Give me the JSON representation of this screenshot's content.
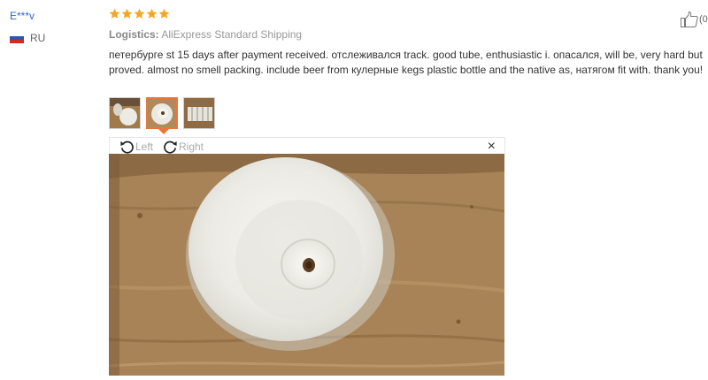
{
  "reviewer": {
    "name": "E***v",
    "country": "RU"
  },
  "rating": {
    "stars": 5,
    "color": "#f5a623"
  },
  "logistics": {
    "label": "Logistics:",
    "value": "AliExpress Standard Shipping"
  },
  "review": {
    "text": "петербурге st 15 days after payment received. отслеживался track. good tube, enthusiastic i. опасался, will be, very hard but proved. almost no smell packing. include beer from кулерные kegs plastic bottle and the native as, натягом fit with. thank you!"
  },
  "helpful": {
    "count_text": "(0"
  },
  "thumbnails": [
    {
      "icon": "photo-thumbnail",
      "active": false
    },
    {
      "icon": "photo-thumbnail",
      "active": true
    },
    {
      "icon": "photo-thumbnail",
      "active": false
    }
  ],
  "viewer": {
    "rotate_left_label": "Left",
    "rotate_right_label": "Right",
    "close_label": "×"
  },
  "colors": {
    "accent": "#e8773c",
    "link": "#3366cc"
  }
}
